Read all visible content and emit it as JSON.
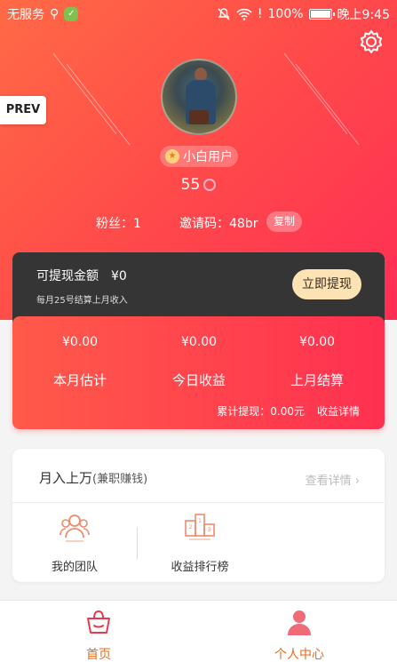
{
  "status_bar": {
    "carrier": "无服务",
    "battery": "100%",
    "time": "晚上9:45"
  },
  "prev_label": "PREV",
  "profile": {
    "rank_label": "小白用户",
    "score": "55",
    "fans": "粉丝：1",
    "invite_code": "邀请码：48br",
    "copy_label": "复制"
  },
  "withdraw": {
    "title": "可提现金额",
    "amount": "¥0",
    "note": "每月25号结算上月收入",
    "button": "立即提现"
  },
  "earnings": {
    "columns": [
      {
        "value": "¥0.00",
        "label": "本月估计"
      },
      {
        "value": "¥0.00",
        "label": "今日收益"
      },
      {
        "value": "¥0.00",
        "label": "上月结算"
      }
    ],
    "total": "累计提现：0.00元",
    "detail_link": "收益详情"
  },
  "card": {
    "title": "月入上万",
    "subtitle": "(兼职赚钱)",
    "more": "查看详情",
    "items": [
      {
        "label": "我的团队",
        "icon": "team-icon"
      },
      {
        "label": "收益排行榜",
        "icon": "ranking-icon"
      }
    ]
  },
  "tabbar": {
    "home": "首页",
    "me": "个人中心"
  },
  "colors": {
    "brand_gradient_start": "#ff6a45",
    "brand_gradient_end": "#ff2d55",
    "tab_active": "#e86a1a",
    "tab_home": "#e86a1a",
    "withdraw_btn": "#fde3b4"
  }
}
